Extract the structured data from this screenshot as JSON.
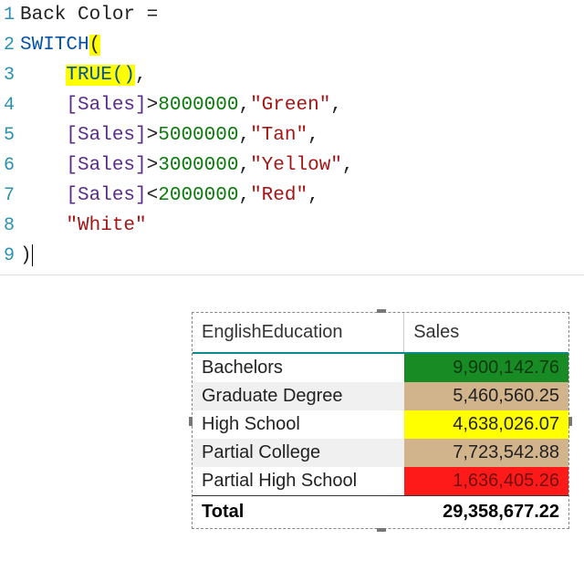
{
  "editor": {
    "lines": [
      {
        "no": "1",
        "tokens": [
          {
            "cls": "txt",
            "t": "Back Color = "
          }
        ]
      },
      {
        "no": "2",
        "tokens": [
          {
            "cls": "kw",
            "t": "SWITCH"
          },
          {
            "cls": "txt hl",
            "t": "("
          }
        ]
      },
      {
        "no": "3",
        "tokens": [
          {
            "cls": "txt",
            "t": "    "
          },
          {
            "cls": "fn hl",
            "t": "TRUE()"
          },
          {
            "cls": "txt",
            "t": ","
          }
        ]
      },
      {
        "no": "4",
        "tokens": [
          {
            "cls": "txt",
            "t": "    "
          },
          {
            "cls": "ref",
            "t": "[Sales]"
          },
          {
            "cls": "txt",
            "t": ">"
          },
          {
            "cls": "num",
            "t": "8000000"
          },
          {
            "cls": "txt",
            "t": ","
          },
          {
            "cls": "str",
            "t": "\"Green\""
          },
          {
            "cls": "txt",
            "t": ","
          }
        ]
      },
      {
        "no": "5",
        "tokens": [
          {
            "cls": "txt",
            "t": "    "
          },
          {
            "cls": "ref",
            "t": "[Sales]"
          },
          {
            "cls": "txt",
            "t": ">"
          },
          {
            "cls": "num",
            "t": "5000000"
          },
          {
            "cls": "txt",
            "t": ","
          },
          {
            "cls": "str",
            "t": "\"Tan\""
          },
          {
            "cls": "txt",
            "t": ","
          }
        ]
      },
      {
        "no": "6",
        "tokens": [
          {
            "cls": "txt",
            "t": "    "
          },
          {
            "cls": "ref",
            "t": "[Sales]"
          },
          {
            "cls": "txt",
            "t": ">"
          },
          {
            "cls": "num",
            "t": "3000000"
          },
          {
            "cls": "txt",
            "t": ","
          },
          {
            "cls": "str",
            "t": "\"Yellow\""
          },
          {
            "cls": "txt",
            "t": ","
          }
        ]
      },
      {
        "no": "7",
        "tokens": [
          {
            "cls": "txt",
            "t": "    "
          },
          {
            "cls": "ref",
            "t": "[Sales]"
          },
          {
            "cls": "txt",
            "t": "<"
          },
          {
            "cls": "num",
            "t": "2000000"
          },
          {
            "cls": "txt",
            "t": ","
          },
          {
            "cls": "str",
            "t": "\"Red\""
          },
          {
            "cls": "txt",
            "t": ","
          }
        ]
      },
      {
        "no": "8",
        "tokens": [
          {
            "cls": "txt",
            "t": "    "
          },
          {
            "cls": "str",
            "t": "\"White\""
          }
        ]
      },
      {
        "no": "9",
        "tokens": [
          {
            "cls": "txt",
            "t": ")"
          }
        ],
        "caret": true
      }
    ]
  },
  "table": {
    "headers": {
      "col1": "EnglishEducation",
      "col2": "Sales"
    },
    "rows": [
      {
        "label": "Bachelors",
        "sales": "9,900,142.76",
        "bg": "bg-green"
      },
      {
        "label": "Graduate Degree",
        "sales": "5,460,560.25",
        "bg": "bg-tan"
      },
      {
        "label": "High School",
        "sales": "4,638,026.07",
        "bg": "bg-yellow"
      },
      {
        "label": "Partial College",
        "sales": "7,723,542.88",
        "bg": "bg-tan"
      },
      {
        "label": "Partial High School",
        "sales": "1,636,405.26",
        "bg": "bg-red"
      }
    ],
    "total": {
      "label": "Total",
      "sales": "29,358,677.22"
    }
  },
  "chart_data": {
    "type": "table",
    "title": "Sales by EnglishEducation with conditional back color",
    "columns": [
      "EnglishEducation",
      "Sales"
    ],
    "rows": [
      [
        "Bachelors",
        9900142.76
      ],
      [
        "Graduate Degree",
        5460560.25
      ],
      [
        "High School",
        4638026.07
      ],
      [
        "Partial College",
        7723542.88
      ],
      [
        "Partial High School",
        1636405.26
      ]
    ],
    "total": 29358677.22,
    "conditional_format": {
      "measure": "Back Color",
      "rules": [
        {
          "test": "Sales > 8000000",
          "color": "Green"
        },
        {
          "test": "Sales > 5000000",
          "color": "Tan"
        },
        {
          "test": "Sales > 3000000",
          "color": "Yellow"
        },
        {
          "test": "Sales < 2000000",
          "color": "Red"
        },
        {
          "default": true,
          "color": "White"
        }
      ]
    }
  }
}
